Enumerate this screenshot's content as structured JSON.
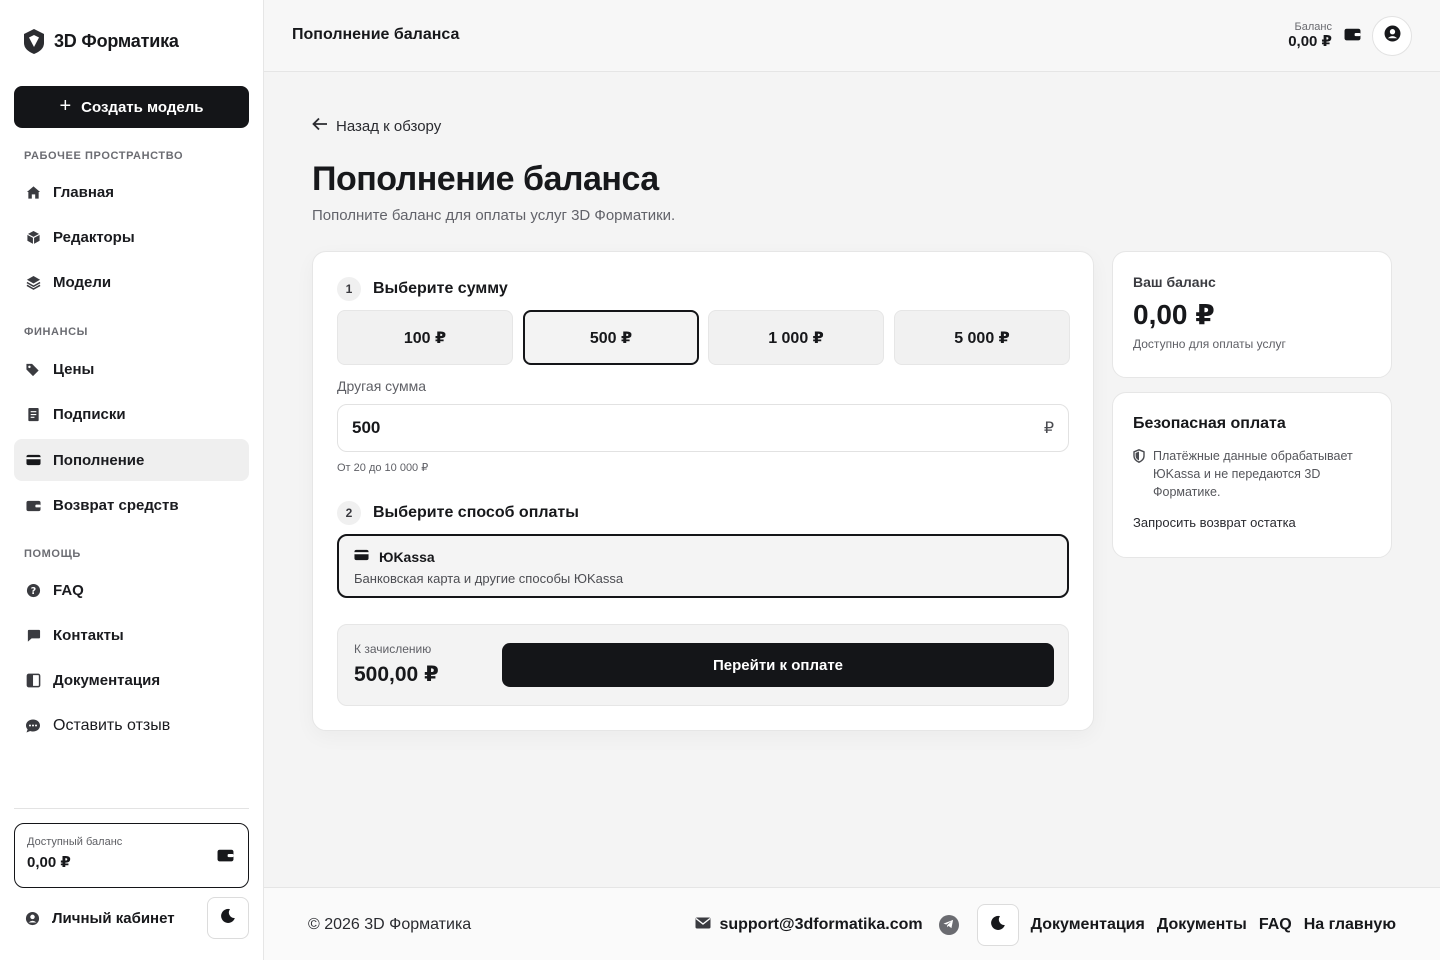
{
  "brand": {
    "name": "3D Форматика",
    "logo_icon": "shield-logo-icon"
  },
  "sidebar": {
    "create_label": "Создать модель",
    "sections": {
      "workspace": "Рабочее пространство",
      "finance": "Финансы",
      "help": "Помощь"
    },
    "items": [
      {
        "label": "Главная",
        "icon": "home-icon"
      },
      {
        "label": "Редакторы",
        "icon": "cube-icon"
      },
      {
        "label": "Модели",
        "icon": "layers-icon"
      },
      {
        "label": "Цены",
        "icon": "tags-icon"
      },
      {
        "label": "Подписки",
        "icon": "receipt-icon"
      },
      {
        "label": "Пополнение",
        "icon": "card-icon",
        "active": true
      },
      {
        "label": "Возврат средств",
        "icon": "wallet-icon"
      },
      {
        "label": "FAQ",
        "icon": "question-icon"
      },
      {
        "label": "Контакты",
        "icon": "chat-icon"
      },
      {
        "label": "Документация",
        "icon": "book-icon"
      },
      {
        "label": "Оставить отзыв",
        "icon": "comment-dots-icon"
      }
    ],
    "balance": {
      "label": "Доступный баланс",
      "value": "0,00 ₽"
    },
    "cabinet_label": "Личный кабинет"
  },
  "topbar": {
    "title": "Пополнение баланса",
    "balance_label": "Баланс",
    "balance_value": "0,00 ₽"
  },
  "main": {
    "back_label": "Назад к обзору",
    "title": "Пополнение баланса",
    "subtitle": "Пополните баланс для оплаты услуг 3D Форматики.",
    "step1": {
      "num": "1",
      "title": "Выберите сумму"
    },
    "amounts": [
      "100 ₽",
      "500 ₽",
      "1 000 ₽",
      "5 000 ₽"
    ],
    "selected_amount_index": 1,
    "other_label": "Другая сумма",
    "other_value": "500",
    "currency": "₽",
    "hint": "От 20 до 10 000 ₽",
    "step2": {
      "num": "2",
      "title": "Выберите способ оплаты"
    },
    "method": {
      "name": "ЮKassa",
      "desc": "Банковская карта и другие способы ЮKassa"
    },
    "summary": {
      "label": "К зачислению",
      "value": "500,00 ₽"
    },
    "pay_label": "Перейти к оплате"
  },
  "balance_card": {
    "label": "Ваш баланс",
    "value": "0,00 ₽",
    "sub": "Доступно для оплаты услуг"
  },
  "secure_card": {
    "title": "Безопасная оплата",
    "text": "Платёжные данные обрабатывает ЮKassa и не передаются 3D Форматике.",
    "link": "Запросить возврат остатка"
  },
  "footer": {
    "copyright": "© 2026 3D Форматика",
    "email": "support@3dformatika.com",
    "links": [
      "Документация",
      "Документы",
      "FAQ",
      "На главную"
    ]
  },
  "colors": {
    "primary": "#141518",
    "background": "#f4f4f4",
    "surface": "#ffffff"
  }
}
